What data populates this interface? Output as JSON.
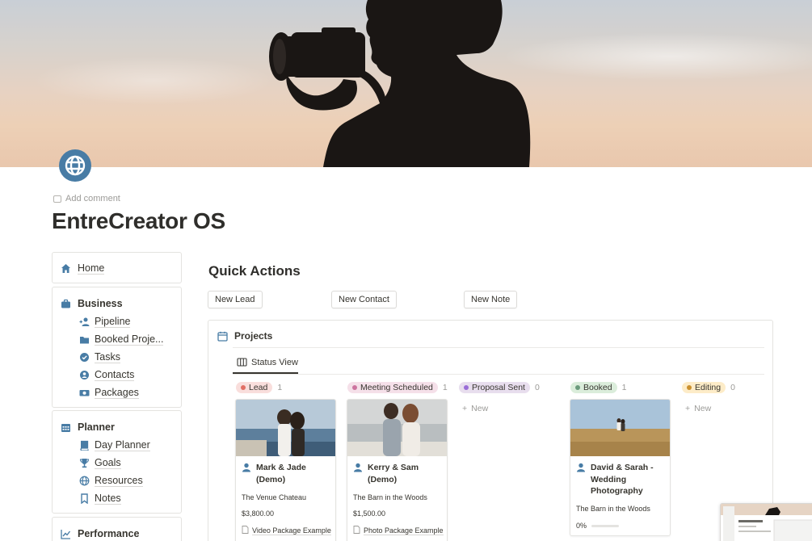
{
  "page": {
    "title": "EntreCreator OS",
    "add_comment": "Add comment",
    "icon": "globe-icon"
  },
  "sidebar": {
    "home": {
      "label": "Home",
      "icon": "house-icon"
    },
    "business": {
      "label": "Business",
      "icon": "briefcase-icon",
      "items": [
        {
          "label": "Pipeline",
          "icon": "add-person-icon"
        },
        {
          "label": "Booked Proje...",
          "icon": "folder-icon"
        },
        {
          "label": "Tasks",
          "icon": "checkmark-circle-icon"
        },
        {
          "label": "Contacts",
          "icon": "user-circle-icon"
        },
        {
          "label": "Packages",
          "icon": "money-icon"
        }
      ]
    },
    "planner": {
      "label": "Planner",
      "icon": "calendar-icon",
      "items": [
        {
          "label": "Day Planner",
          "icon": "book-icon"
        },
        {
          "label": "Goals",
          "icon": "trophy-icon"
        },
        {
          "label": "Resources",
          "icon": "globe-icon"
        },
        {
          "label": "Notes",
          "icon": "bookmark-icon"
        }
      ]
    },
    "performance": {
      "label": "Performance",
      "icon": "chart-icon"
    }
  },
  "quick_actions": {
    "title": "Quick Actions",
    "buttons": [
      "New Lead",
      "New Contact",
      "New Note"
    ]
  },
  "projects": {
    "title": "Projects",
    "view_tab": "Status View",
    "new_label": "New",
    "columns": [
      {
        "status": "Lead",
        "count": "1",
        "color": "#f9dedc",
        "dot": "#e16f64"
      },
      {
        "status": "Meeting Scheduled",
        "count": "1",
        "color": "#f5e0e9",
        "dot": "#cd749f"
      },
      {
        "status": "Proposal Sent",
        "count": "0",
        "color": "#e8deee",
        "dot": "#9a6dd7"
      },
      {
        "status": "Booked",
        "count": "1",
        "color": "#dbeddb",
        "dot": "#6c9b7d"
      },
      {
        "status": "Editing",
        "count": "0",
        "color": "#fdecc8",
        "dot": "#cb912f"
      }
    ],
    "cards": [
      {
        "name": "Mark & Jade (Demo)",
        "venue": "The Venue Chateau",
        "price": "$3,800.00",
        "package": "Video Package Example"
      },
      {
        "name": "Kerry & Sam (Demo)",
        "venue": "The Barn in the Woods",
        "price": "$1,500.00",
        "package": "Photo Package Example"
      },
      {
        "name": "David & Sarah - Wedding Photography",
        "venue": "The Barn in the Woods",
        "progress": "0%"
      }
    ]
  }
}
